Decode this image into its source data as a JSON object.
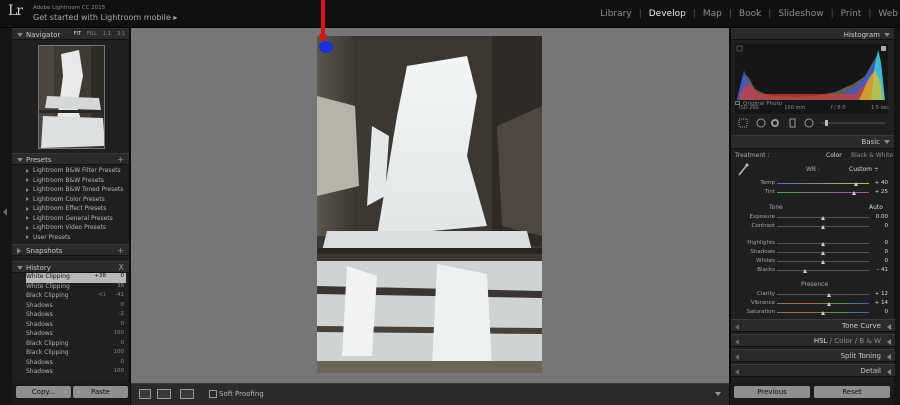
{
  "app": {
    "logo": "Lr",
    "title": "Adobe Lightroom CC 2015",
    "subtitle": "Get started with Lightroom mobile",
    "subtitle_arrow": "▸"
  },
  "modules": [
    {
      "label": "Library",
      "active": false
    },
    {
      "label": "Develop",
      "active": true
    },
    {
      "label": "Map",
      "active": false
    },
    {
      "label": "Book",
      "active": false
    },
    {
      "label": "Slideshow",
      "active": false
    },
    {
      "label": "Print",
      "active": false
    },
    {
      "label": "Web",
      "active": false
    }
  ],
  "navigator": {
    "title": "Navigator",
    "modes": [
      "FIT",
      "FILL",
      "1:1",
      "3:1"
    ]
  },
  "presets": {
    "title": "Presets",
    "plus": "+",
    "items": [
      "Lightroom B&W Filter Presets",
      "Lightroom B&W Presets",
      "Lightroom B&W Toned Presets",
      "Lightroom Color Presets",
      "Lightroom Effect Presets",
      "Lightroom General Presets",
      "Lightroom Video Presets",
      "User Presets"
    ]
  },
  "snapshots": {
    "title": "Snapshots",
    "plus": "+"
  },
  "history": {
    "title": "History",
    "close": "X",
    "rows": [
      {
        "label": "White Clipping",
        "step": "+38",
        "value": "0",
        "selected": true
      },
      {
        "label": "White Clipping",
        "step": "",
        "value": "38",
        "selected": false
      },
      {
        "label": "Black Clipping",
        "step": "-41",
        "value": "-41",
        "selected": false
      },
      {
        "label": "Shadows",
        "step": "",
        "value": "0",
        "selected": false
      },
      {
        "label": "Shadows",
        "step": "",
        "value": "-2",
        "selected": false
      },
      {
        "label": "Shadows",
        "step": "",
        "value": "0",
        "selected": false
      },
      {
        "label": "Shadows",
        "step": "",
        "value": "100",
        "selected": false
      },
      {
        "label": "Black Clipping",
        "step": "",
        "value": "0",
        "selected": false
      },
      {
        "label": "Black Clipping",
        "step": "",
        "value": "100",
        "selected": false
      },
      {
        "label": "Shadows",
        "step": "",
        "value": "0",
        "selected": false
      },
      {
        "label": "Shadows",
        "step": "",
        "value": "100",
        "selected": false
      }
    ]
  },
  "left_buttons": {
    "copy": "Copy...",
    "paste": "Paste"
  },
  "toolbar": {
    "soft_proofing": "Soft Proofing"
  },
  "histogram": {
    "title": "Histogram",
    "iso": "ISO 200",
    "focal": "100 mm",
    "aperture": "f / 8.0",
    "shutter": "1.5 sec",
    "original_photo": "Original Photo"
  },
  "basic": {
    "title": "Basic",
    "treatment_label": "Treatment :",
    "treatment_color": "Color",
    "treatment_bw": "Black & White",
    "wb_label": "WB :",
    "wb_value": "Custom ÷",
    "tone_label": "Tone",
    "auto_label": "Auto",
    "presence_label": "Presence",
    "sliders": [
      {
        "label": "Temp",
        "value": "+ 40",
        "pos": 0.86,
        "group": "wb"
      },
      {
        "label": "Tint",
        "value": "+ 25",
        "pos": 0.84,
        "group": "wb"
      },
      {
        "label": "Exposure",
        "value": "0.00",
        "pos": 0.5,
        "group": "tone"
      },
      {
        "label": "Contrast",
        "value": "0",
        "pos": 0.5,
        "group": "tone"
      },
      {
        "label": "Highlights",
        "value": "0",
        "pos": 0.5,
        "group": "tone"
      },
      {
        "label": "Shadows",
        "value": "0",
        "pos": 0.5,
        "group": "tone"
      },
      {
        "label": "Whites",
        "value": "0",
        "pos": 0.5,
        "group": "tone"
      },
      {
        "label": "Blacks",
        "value": "– 41",
        "pos": 0.3,
        "group": "tone"
      },
      {
        "label": "Clarity",
        "value": "+ 12",
        "pos": 0.56,
        "group": "presence"
      },
      {
        "label": "Vibrance",
        "value": "+ 14",
        "pos": 0.57,
        "group": "presence"
      },
      {
        "label": "Saturation",
        "value": "0",
        "pos": 0.5,
        "group": "presence"
      }
    ]
  },
  "panels": {
    "tone_curve": "Tone Curve",
    "hsl": "HSL",
    "hsl_sep1": "/",
    "color": "Color",
    "hsl_sep2": "/",
    "bw": "B & W",
    "split_toning": "Split Toning",
    "detail": "Detail"
  },
  "right_buttons": {
    "previous": "Previous",
    "reset": "Reset"
  },
  "colors": {
    "annotation_arrow": "#e01010",
    "annotation_blob": "#1a2ee0"
  }
}
